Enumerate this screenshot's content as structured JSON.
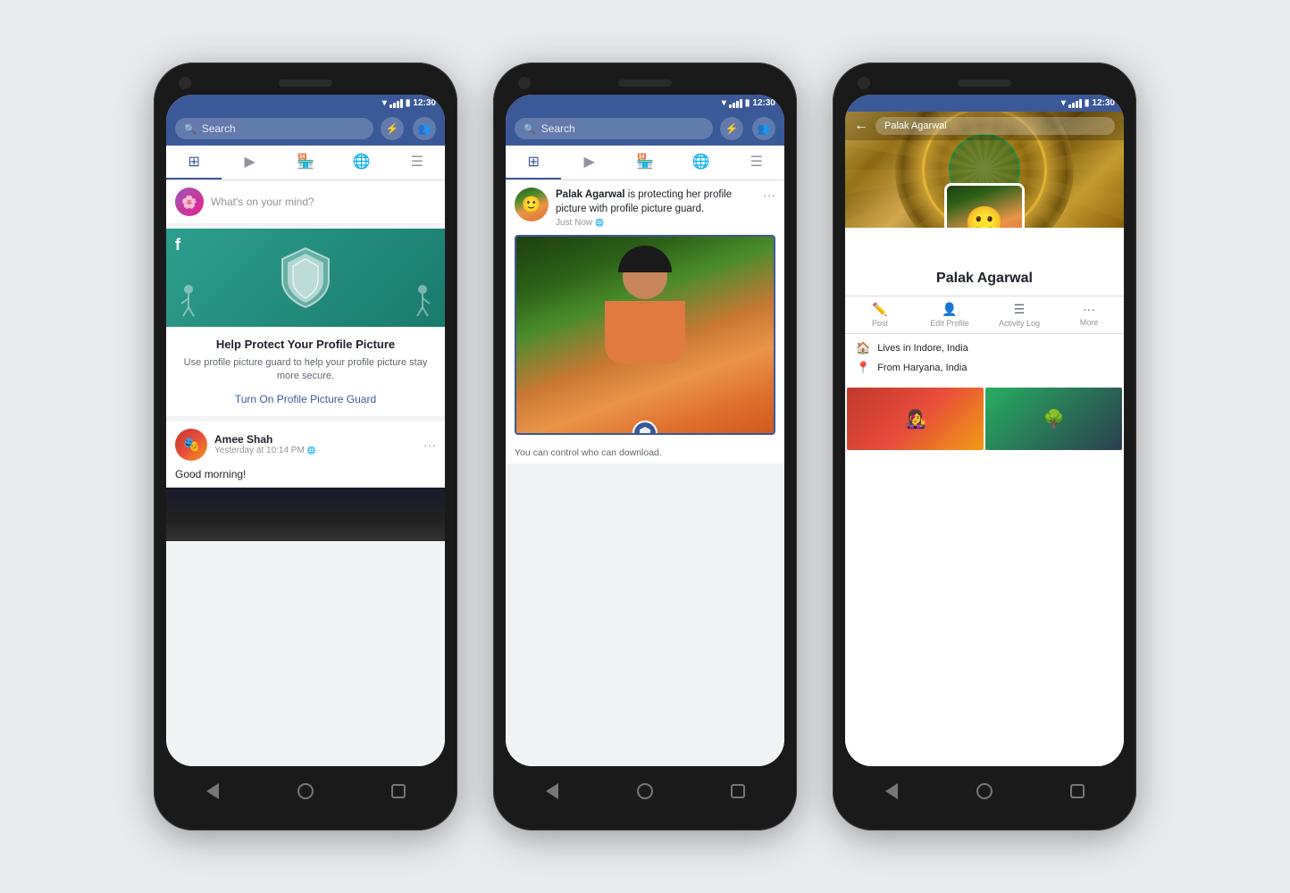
{
  "bg_color": "#e8eaed",
  "phone1": {
    "status_time": "12:30",
    "header": {
      "search_placeholder": "Search",
      "messenger_icon": "💬",
      "friends_icon": "👥"
    },
    "nav_tabs": [
      "news-feed",
      "play",
      "store",
      "globe",
      "menu"
    ],
    "post_box": {
      "placeholder": "What's on your mind?"
    },
    "guard_card": {
      "title": "Help Protect Your Profile Picture",
      "desc": "Use profile picture guard to help your profile picture stay more secure.",
      "cta": "Turn On Profile Picture Guard"
    },
    "post": {
      "name": "Amee Shah",
      "time": "Yesterday at 10:14 PM",
      "text": "Good morning!",
      "more": "···"
    }
  },
  "phone2": {
    "status_time": "12:30",
    "header": {
      "search_placeholder": "Search"
    },
    "post": {
      "name": "Palak Agarwal",
      "action": "is protecting her profile picture with profile picture guard.",
      "time": "Just Now",
      "more": "···"
    },
    "download_text": "You can control who can download."
  },
  "phone3": {
    "status_time": "12:30",
    "search_text": "Palak Agarwal",
    "profile_name": "Palak Agarwal",
    "actions": [
      "Post",
      "Edit Profile",
      "Activity Log",
      "More"
    ],
    "info": [
      {
        "icon": "🏠",
        "text": "Lives in Indore, India"
      },
      {
        "icon": "📍",
        "text": "From Haryana, India"
      }
    ]
  }
}
